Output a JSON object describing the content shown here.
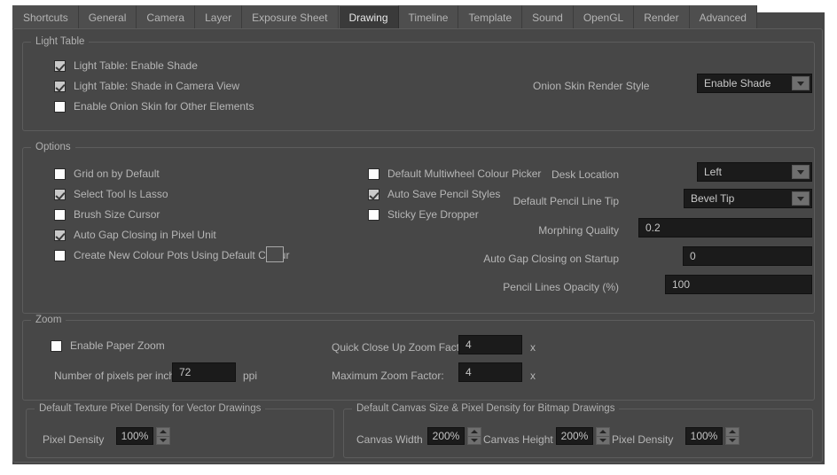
{
  "tabs": [
    {
      "label": "Shortcuts",
      "active": false
    },
    {
      "label": "General",
      "active": false
    },
    {
      "label": "Camera",
      "active": false
    },
    {
      "label": "Layer",
      "active": false
    },
    {
      "label": "Exposure Sheet",
      "active": false
    },
    {
      "label": "Drawing",
      "active": true
    },
    {
      "label": "Timeline",
      "active": false
    },
    {
      "label": "Template",
      "active": false
    },
    {
      "label": "Sound",
      "active": false
    },
    {
      "label": "OpenGL",
      "active": false
    },
    {
      "label": "Render",
      "active": false
    },
    {
      "label": "Advanced",
      "active": false
    }
  ],
  "light_table": {
    "title": "Light Table",
    "checkboxes": [
      {
        "label": "Light Table: Enable Shade",
        "checked": true
      },
      {
        "label": "Light Table: Shade in Camera View",
        "checked": true
      },
      {
        "label": "Enable Onion Skin for Other Elements",
        "checked": false
      }
    ],
    "onion_skin_render_style": {
      "label": "Onion Skin Render Style",
      "value": "Enable Shade"
    }
  },
  "options": {
    "title": "Options",
    "col1": [
      {
        "label": "Grid on by Default",
        "checked": false
      },
      {
        "label": "Select Tool Is Lasso",
        "checked": true
      },
      {
        "label": "Brush Size Cursor",
        "checked": false
      },
      {
        "label": "Auto Gap Closing in Pixel Unit",
        "checked": true
      },
      {
        "label": "Create New Colour Pots Using Default Colour",
        "checked": false
      }
    ],
    "col2": [
      {
        "label": "Default Multiwheel Colour Picker",
        "checked": false
      },
      {
        "label": "Auto Save Pencil Styles",
        "checked": true
      },
      {
        "label": "Sticky Eye Dropper",
        "checked": false
      }
    ],
    "desk_location": {
      "label": "Desk Location",
      "value": "Left"
    },
    "default_pencil_line_tip": {
      "label": "Default Pencil Line Tip",
      "value": "Bevel Tip"
    },
    "morphing_quality": {
      "label": "Morphing Quality",
      "value": "0.2"
    },
    "auto_gap_closing_on_startup": {
      "label": "Auto Gap Closing on Startup",
      "value": "0"
    },
    "pencil_lines_opacity": {
      "label": "Pencil Lines Opacity (%)",
      "value": "100"
    }
  },
  "zoom": {
    "title": "Zoom",
    "enable_paper_zoom": {
      "label": "Enable Paper Zoom",
      "checked": false
    },
    "pixels_per_inch": {
      "label": "Number of pixels per inch:",
      "value": "72",
      "suffix": "ppi"
    },
    "quick_close_up_zoom_factor": {
      "label": "Quick Close Up Zoom Factor",
      "value": "4",
      "suffix": "x"
    },
    "maximum_zoom_factor": {
      "label": "Maximum Zoom Factor:",
      "value": "4",
      "suffix": "x"
    }
  },
  "vector_density": {
    "title": "Default Texture Pixel Density for Vector Drawings",
    "pixel_density": {
      "label": "Pixel Density",
      "value": "100%"
    }
  },
  "bitmap_density": {
    "title": "Default Canvas Size & Pixel Density for Bitmap Drawings",
    "canvas_width": {
      "label": "Canvas Width",
      "value": "200%"
    },
    "canvas_height": {
      "label": "Canvas Height",
      "value": "200%"
    },
    "pixel_density": {
      "label": "Pixel Density",
      "value": "100%"
    }
  },
  "icons": {
    "combo_arrow": "chevron-down-icon",
    "spin_up": "spinner-up-icon",
    "spin_down": "spinner-down-icon"
  }
}
